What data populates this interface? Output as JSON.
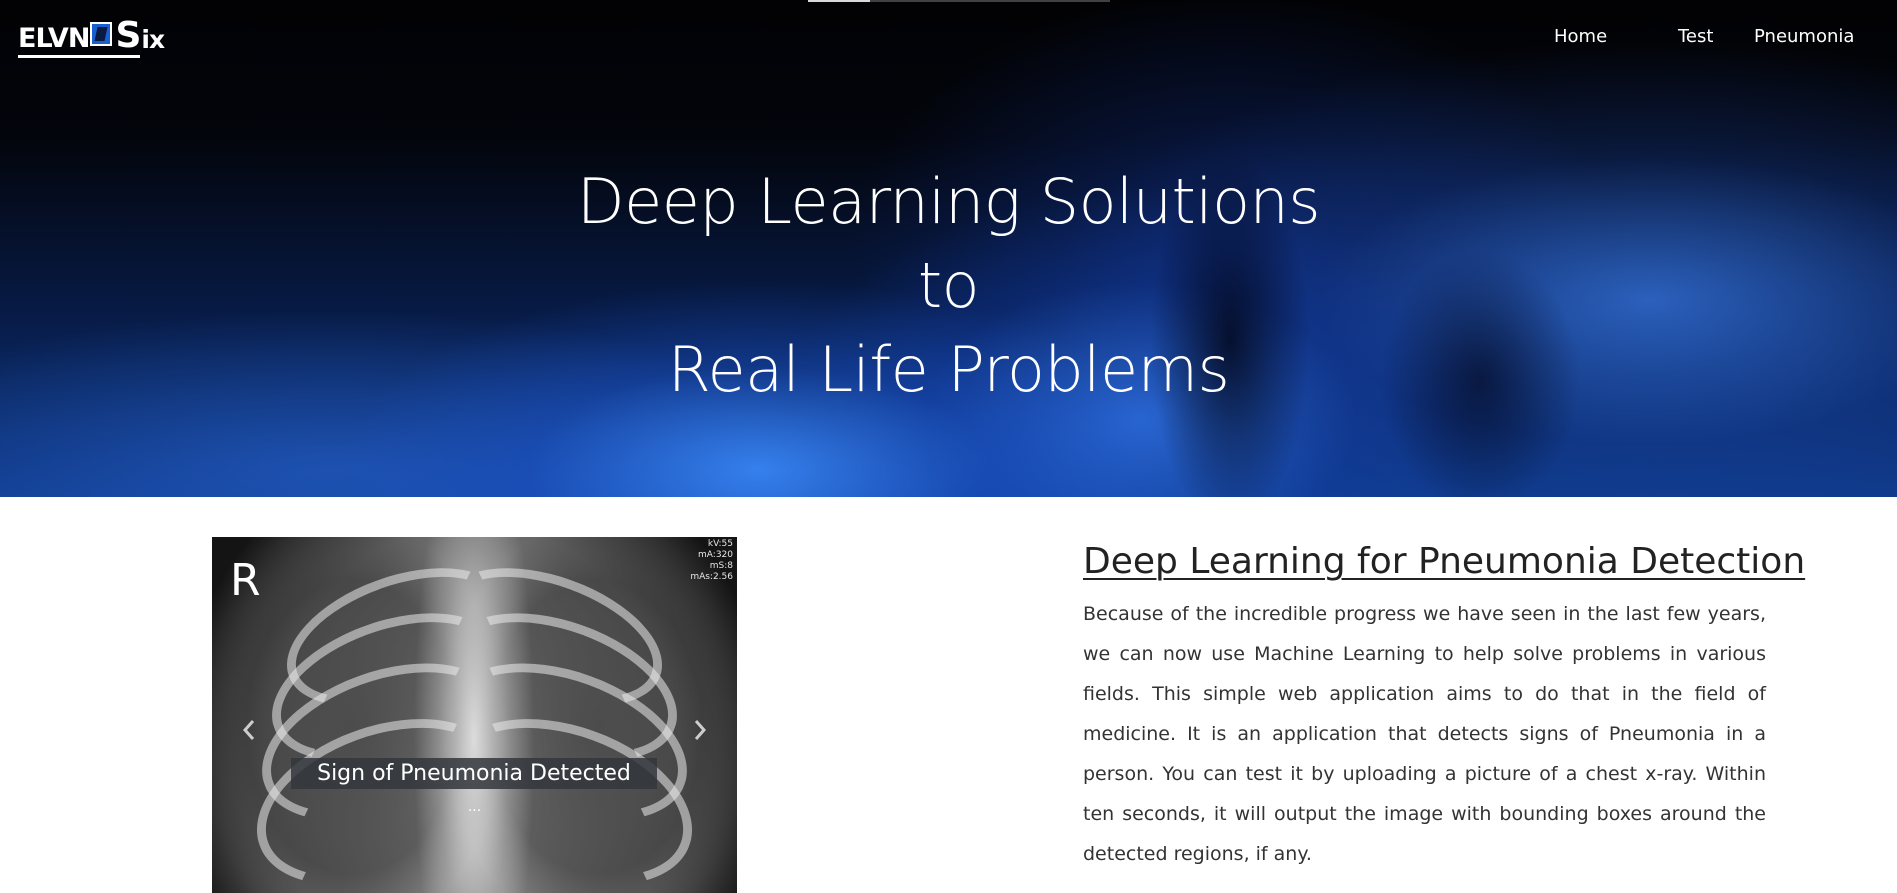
{
  "nav": {
    "logo_text_main": "ELVN",
    "logo_text_s": "S",
    "logo_text_tail": "ix",
    "items": [
      {
        "label": "Home"
      },
      {
        "label": "Test"
      },
      {
        "label": "Pneumonia"
      }
    ]
  },
  "hero": {
    "line1": "Deep Learning Solutions",
    "line2": "to",
    "line3": "Real Life Problems"
  },
  "carousel": {
    "marker": "R",
    "meta": [
      "kV:55",
      "mA:320",
      "mS:8",
      "mAs:2.56"
    ],
    "caption": "Sign of Pneumonia Detected",
    "caption_sub": "...",
    "prev_icon": "chevron-left-icon",
    "next_icon": "chevron-right-icon"
  },
  "article": {
    "title": "Deep Learning for Pneumonia Detection",
    "body": "Because of the incredible progress we have seen in the last few years, we can now use Machine Learning to help solve problems in various fields. This simple web application aims to do that in the field of medicine. It is an application that detects signs of Pneumonia in a person. You can test it by uploading a picture of a chest x-ray. Within ten seconds, it will output the image with bounding boxes around the detected regions, if any."
  },
  "colors": {
    "accent": "#1a5fd0",
    "hero_dark": "#020204",
    "text": "#333333"
  }
}
